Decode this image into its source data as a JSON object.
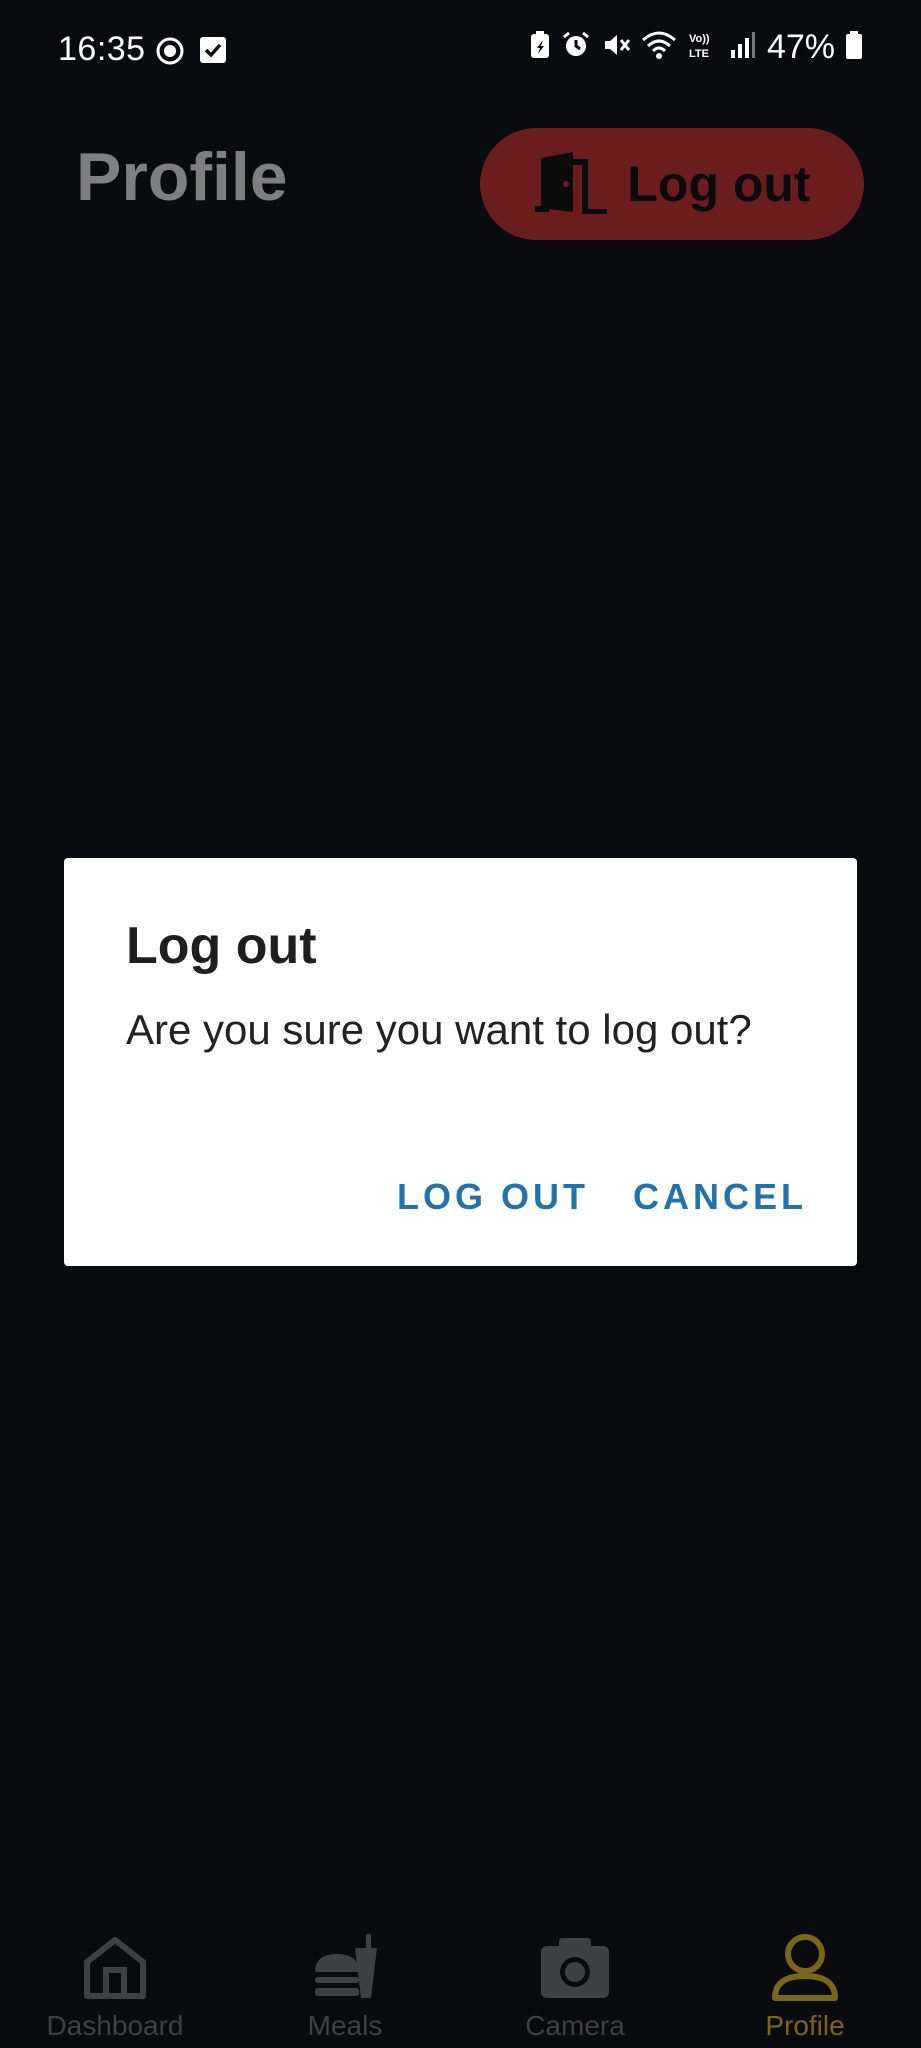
{
  "status_bar": {
    "time": "16:35",
    "battery": "47%",
    "left_icons": [
      "data-saver-icon",
      "check-box-icon"
    ],
    "right_icons": [
      "battery-saver-icon",
      "alarm-icon",
      "mute-icon",
      "wifi-icon",
      "volte-icon",
      "signal-icon",
      "battery-icon"
    ]
  },
  "header": {
    "title": "Profile",
    "logout_label": "Log out"
  },
  "dialog": {
    "title": "Log out",
    "message": "Are you sure you want to log out?",
    "confirm_label": "LOG OUT",
    "cancel_label": "CANCEL"
  },
  "nav": {
    "items": [
      {
        "label": "Dashboard",
        "icon": "home-icon"
      },
      {
        "label": "Meals",
        "icon": "meals-icon"
      },
      {
        "label": "Camera",
        "icon": "camera-icon"
      },
      {
        "label": "Profile",
        "icon": "profile-icon",
        "active": true
      }
    ]
  },
  "colors": {
    "accent": "#2273ad",
    "logout_button": "#6b1d1d",
    "nav_active": "#7a6519",
    "background": "#0a0b0f"
  }
}
